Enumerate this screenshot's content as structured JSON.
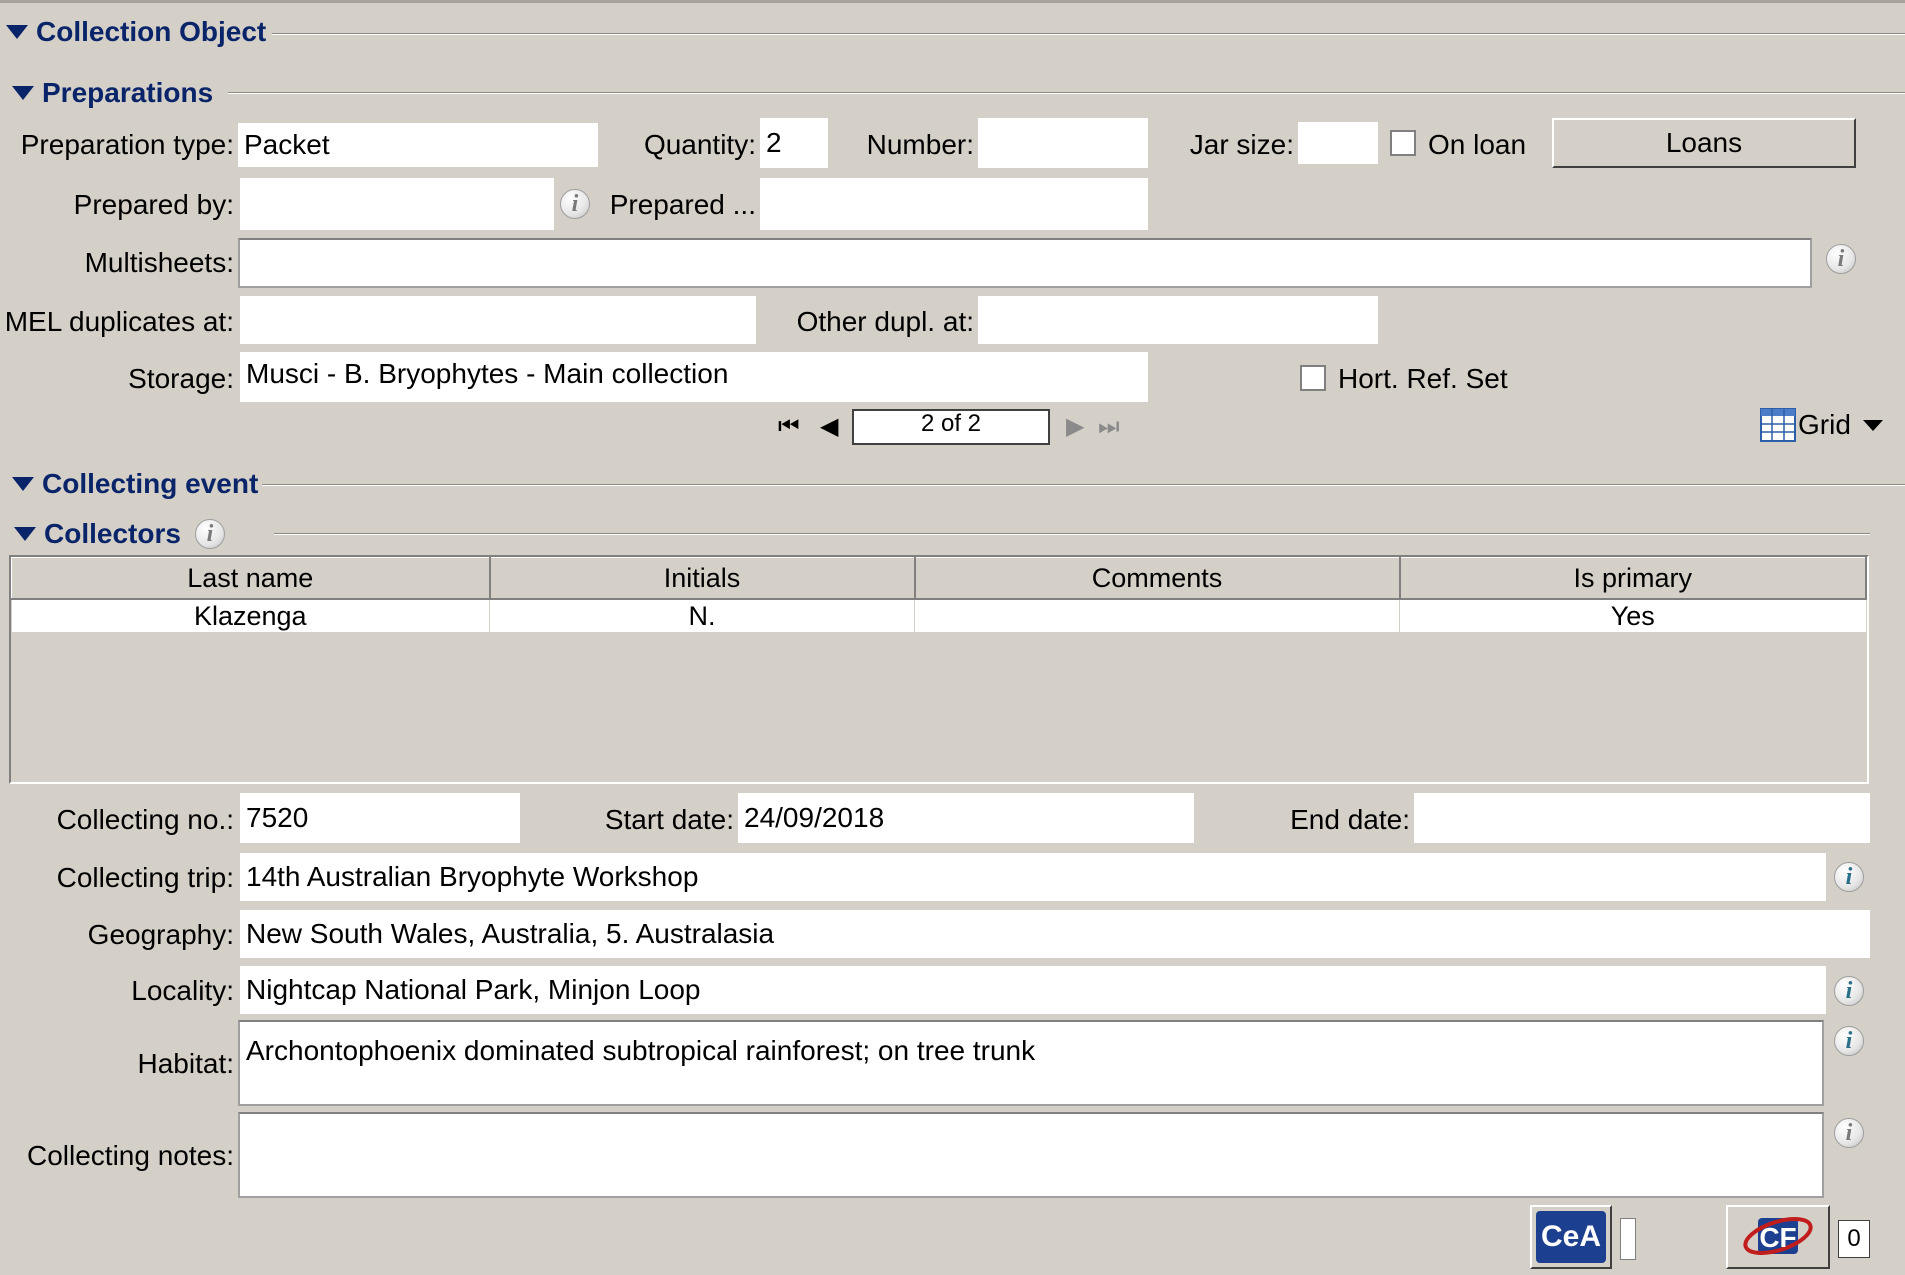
{
  "sections": {
    "collection_object": "Collection Object",
    "preparations": "Preparations",
    "collecting_event": "Collecting event",
    "collectors": "Collectors"
  },
  "preparations": {
    "preparation_type_label": "Preparation type:",
    "preparation_type_value": "Packet",
    "quantity_label": "Quantity:",
    "quantity_value": "2",
    "number_label": "Number:",
    "number_value": "",
    "jar_size_label": "Jar size:",
    "jar_size_value": "",
    "on_loan_label": "On loan",
    "on_loan_checked": false,
    "loans_button": "Loans",
    "prepared_by_label": "Prepared by:",
    "prepared_by_value": "",
    "prepared_date_label": "Prepared ...",
    "prepared_date_value": "",
    "multisheets_label": "Multisheets:",
    "multisheets_value": "",
    "mel_duplicates_label": "MEL duplicates at:",
    "mel_duplicates_value": "",
    "other_dupl_label": "Other dupl. at:",
    "other_dupl_value": "",
    "storage_label": "Storage:",
    "storage_value": "Musci - B. Bryophytes - Main collection",
    "hort_ref_label": "Hort. Ref. Set",
    "hort_ref_checked": false,
    "pager_text": "2 of 2",
    "grid_label": "Grid"
  },
  "collectors": {
    "columns": [
      "Last name",
      "Initials",
      "Comments",
      "Is primary"
    ],
    "rows": [
      [
        "Klazenga",
        "N.",
        "",
        "Yes"
      ]
    ]
  },
  "collecting_event": {
    "collecting_no_label": "Collecting no.:",
    "collecting_no_value": "7520",
    "start_date_label": "Start date:",
    "start_date_value": "24/09/2018",
    "end_date_label": "End date:",
    "end_date_value": "",
    "collecting_trip_label": "Collecting trip:",
    "collecting_trip_value": "14th Australian Bryophyte Workshop",
    "geography_label": "Geography:",
    "geography_value": "New South Wales, Australia, 5. Australasia",
    "locality_label": "Locality:",
    "locality_value": "Nightcap National Park, Minjon Loop",
    "habitat_label": "Habitat:",
    "habitat_value": "Archontophoenix dominated subtropical rainforest; on tree trunk",
    "collecting_notes_label": "Collecting notes:",
    "collecting_notes_value": ""
  },
  "footer": {
    "cea_label": "CeA",
    "cf_label": "CF",
    "cf_count": "0"
  },
  "icons": {
    "info": "i",
    "collapse": "triangle-down-icon"
  }
}
